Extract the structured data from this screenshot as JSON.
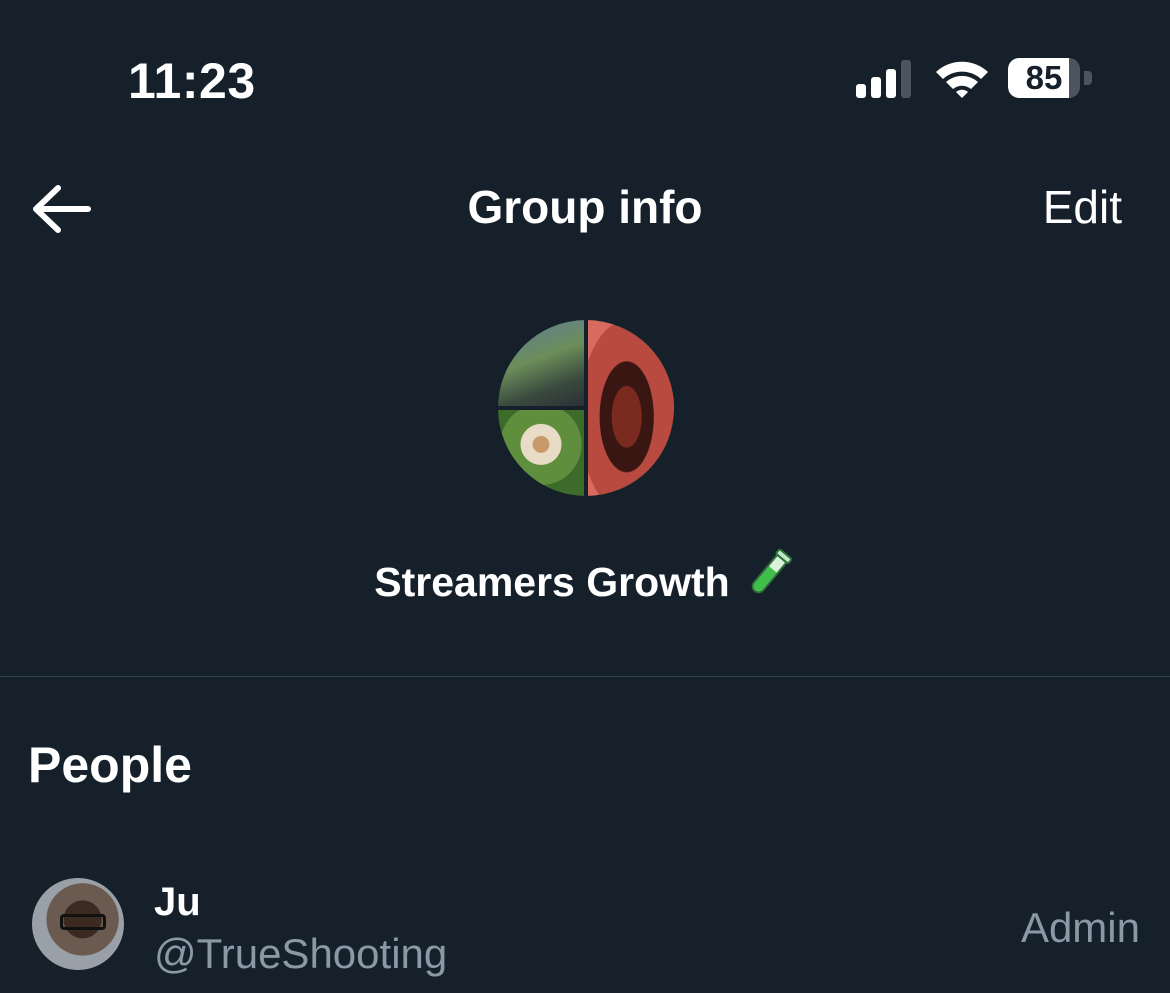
{
  "status_bar": {
    "time": "11:23",
    "battery_level": "85",
    "battery_fraction": 0.85,
    "signal_icon": "cellular-signal-icon",
    "wifi_icon": "wifi-icon"
  },
  "nav": {
    "back_icon": "arrow-left-icon",
    "title": "Group info",
    "edit_label": "Edit"
  },
  "group": {
    "name": "Streamers Growth",
    "emoji_icon": "test-tube-icon"
  },
  "people": {
    "section_title": "People",
    "members": [
      {
        "name": "Ju",
        "handle": "@TrueShooting",
        "role": "Admin"
      }
    ]
  },
  "colors": {
    "background": "#15202b",
    "secondary_text": "#8b98a5",
    "divider": "#38444d"
  }
}
